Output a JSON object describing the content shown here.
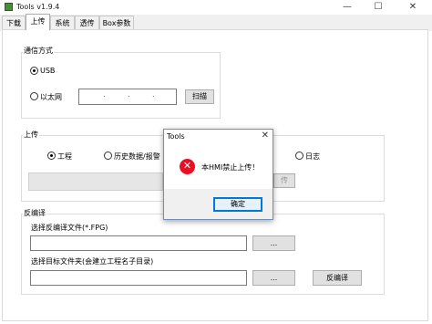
{
  "window": {
    "title": "Tools v1.9.4",
    "minimize_glyph": "—",
    "maximize_glyph": "☐",
    "close_glyph": "✕"
  },
  "tabs": [
    {
      "label": "下载",
      "active": false
    },
    {
      "label": "上传",
      "active": true
    },
    {
      "label": "系统",
      "active": false
    },
    {
      "label": "透传",
      "active": false
    },
    {
      "label": "Box参数",
      "active": false
    }
  ],
  "comm": {
    "label": "通信方式",
    "usb_label": "USB",
    "ethernet_label": "以太网",
    "ip_dots": ".",
    "scan_button": "扫描"
  },
  "upload": {
    "label": "上传",
    "options": [
      "工程",
      "历史数据/报警",
      "日志"
    ],
    "selected": "工程",
    "button_fragment": "传"
  },
  "decompile": {
    "label": "反编译",
    "source_label": "选择反编译文件(*.FPG)",
    "target_label": "选择目标文件夹(会建立工程名子目录)",
    "browse_label": "...",
    "decompile_button": "反编译",
    "source_value": "",
    "target_value": ""
  },
  "dialog": {
    "title": "Tools",
    "message": "本HMI禁止上传！",
    "ok_button": "确定",
    "close_glyph": "✕",
    "icon_glyph": "✕"
  }
}
